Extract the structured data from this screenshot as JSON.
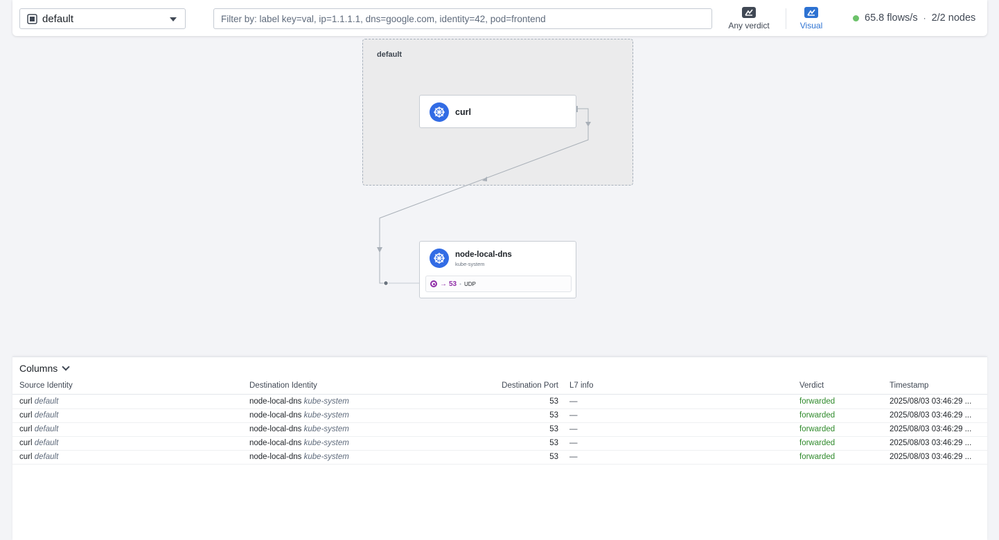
{
  "toolbar": {
    "namespace": "default",
    "filter_placeholder": "Filter by: label key=val, ip=1.1.1.1, dns=google.com, identity=42, pod=frontend",
    "verdict_label": "Any verdict",
    "visual_label": "Visual",
    "flows_rate": "65.8 flows/s",
    "separator": "·",
    "nodes": "2/2 nodes",
    "status_color": "#6cc26a"
  },
  "map": {
    "namespace_box_label": "default",
    "nodes": [
      {
        "title": "curl",
        "icon": "kubernetes-icon"
      },
      {
        "title": "node-local-dns",
        "subtitle": "kube-system",
        "icon": "kubernetes-icon",
        "port": {
          "arrow": "→",
          "number": "53",
          "separator": "•",
          "protocol": "UDP"
        }
      }
    ]
  },
  "flows": {
    "columns_label": "Columns",
    "headers": [
      "Source Identity",
      "Destination Identity",
      "Destination Port",
      "L7 info",
      "Verdict",
      "Timestamp"
    ],
    "rows": [
      {
        "src": "curl",
        "src_ns": "default",
        "dst": "node-local-dns",
        "dst_ns": "kube-system",
        "port": "53",
        "l7": "—",
        "verdict": "forwarded",
        "timestamp": "2025/08/03 03:46:29 ..."
      },
      {
        "src": "curl",
        "src_ns": "default",
        "dst": "node-local-dns",
        "dst_ns": "kube-system",
        "port": "53",
        "l7": "—",
        "verdict": "forwarded",
        "timestamp": "2025/08/03 03:46:29 ..."
      },
      {
        "src": "curl",
        "src_ns": "default",
        "dst": "node-local-dns",
        "dst_ns": "kube-system",
        "port": "53",
        "l7": "—",
        "verdict": "forwarded",
        "timestamp": "2025/08/03 03:46:29 ..."
      },
      {
        "src": "curl",
        "src_ns": "default",
        "dst": "node-local-dns",
        "dst_ns": "kube-system",
        "port": "53",
        "l7": "—",
        "verdict": "forwarded",
        "timestamp": "2025/08/03 03:46:29 ..."
      },
      {
        "src": "curl",
        "src_ns": "default",
        "dst": "node-local-dns",
        "dst_ns": "kube-system",
        "port": "53",
        "l7": "—",
        "verdict": "forwarded",
        "timestamp": "2025/08/03 03:46:29 ..."
      }
    ]
  },
  "colors": {
    "accent": "#2d72d2",
    "kubernetes": "#326ce5",
    "port": "#8f2da7",
    "forwarded": "#2f8a2b"
  }
}
